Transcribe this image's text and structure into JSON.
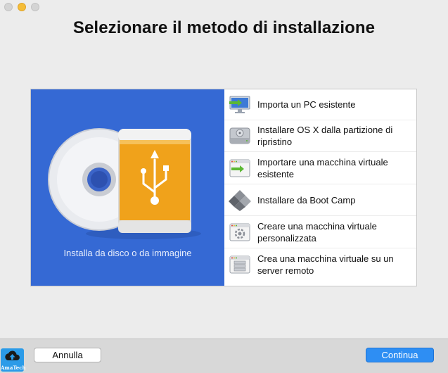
{
  "window": {
    "title": "Selezionare il metodo di installazione"
  },
  "install_source": {
    "label": "Installa da disco o da immagine"
  },
  "options": [
    {
      "label_line1": "Importa un PC esistente",
      "label_line2": "",
      "icon": "monitor-import-icon"
    },
    {
      "label_line1": "Installare OS X dalla partizione di",
      "label_line2": "ripristino",
      "icon": "hard-drive-icon"
    },
    {
      "label_line1": "Importare una macchina virtuale",
      "label_line2": "esistente",
      "icon": "vm-import-icon"
    },
    {
      "label_line1": "Installare da Boot Camp",
      "label_line2": "",
      "icon": "bootcamp-icon"
    },
    {
      "label_line1": "Creare una macchina virtuale",
      "label_line2": "personalizzata",
      "icon": "custom-vm-icon"
    },
    {
      "label_line1": "Crea una macchina virtuale su un",
      "label_line2": "server remoto",
      "icon": "remote-server-icon"
    }
  ],
  "buttons": {
    "cancel": "Annulla",
    "continue": "Continua"
  },
  "watermark": {
    "text": "AmaTech"
  },
  "colors": {
    "left_pane": "#3569d4",
    "continue_button": "#2e8ef3",
    "usb_orange": "#f0a21b"
  }
}
